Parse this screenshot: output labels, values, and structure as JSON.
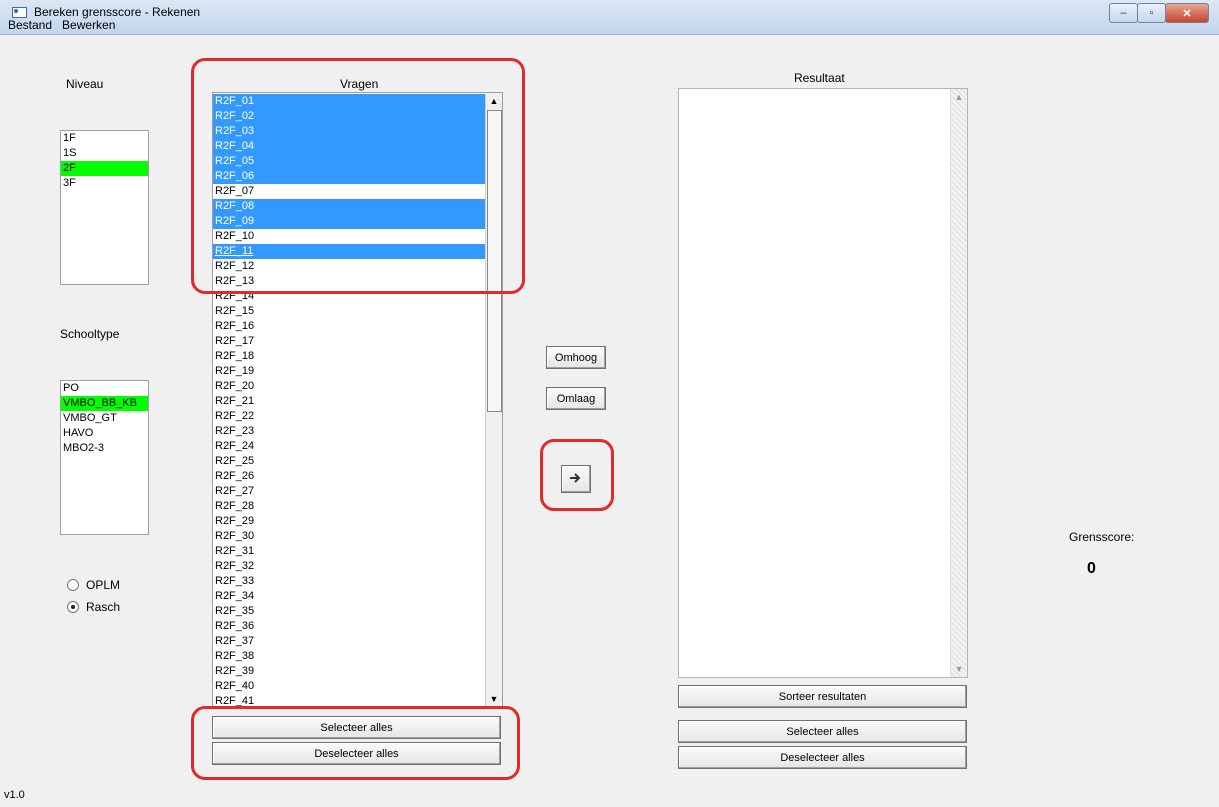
{
  "window": {
    "title": "Bereken grensscore - Rekenen",
    "min": "–",
    "max": "▫",
    "close": "✕"
  },
  "menu": [
    "Bestand",
    "Bewerken"
  ],
  "niveau": {
    "label": "Niveau",
    "items": [
      "1F",
      "1S",
      "2F",
      "3F"
    ],
    "selected": "2F"
  },
  "schooltype": {
    "label": "Schooltype",
    "items": [
      "PO",
      "VMBO_BB_KB",
      "VMBO_GT",
      "HAVO",
      "MBO2-3"
    ],
    "selected": "VMBO_BB_KB"
  },
  "model": {
    "options": [
      {
        "label": "OPLM",
        "checked": false
      },
      {
        "label": "Rasch",
        "checked": true
      }
    ]
  },
  "vragen": {
    "label": "Vragen",
    "items": [
      "R2F_01",
      "R2F_02",
      "R2F_03",
      "R2F_04",
      "R2F_05",
      "R2F_06",
      "R2F_07",
      "R2F_08",
      "R2F_09",
      "R2F_10",
      "R2F_11",
      "R2F_12",
      "R2F_13",
      "R2F_14",
      "R2F_15",
      "R2F_16",
      "R2F_17",
      "R2F_18",
      "R2F_19",
      "R2F_20",
      "R2F_21",
      "R2F_22",
      "R2F_23",
      "R2F_24",
      "R2F_25",
      "R2F_26",
      "R2F_27",
      "R2F_28",
      "R2F_29",
      "R2F_30",
      "R2F_31",
      "R2F_32",
      "R2F_33",
      "R2F_34",
      "R2F_35",
      "R2F_36",
      "R2F_37",
      "R2F_38",
      "R2F_39",
      "R2F_40",
      "R2F_41"
    ],
    "selected": [
      "R2F_01",
      "R2F_02",
      "R2F_03",
      "R2F_04",
      "R2F_05",
      "R2F_06",
      "R2F_08",
      "R2F_09",
      "R2F_11"
    ],
    "focused": "R2F_11",
    "select_all": "Selecteer alles",
    "deselect_all": "Deselecteer alles"
  },
  "middle": {
    "up": "Omhoog",
    "down": "Omlaag",
    "move_icon": "arrow-right-icon"
  },
  "resultaat": {
    "label": "Resultaat",
    "items": [],
    "sort": "Sorteer resultaten",
    "select_all": "Selecteer alles",
    "deselect_all": "Deselecteer alles"
  },
  "grensscore": {
    "label": "Grensscore:",
    "value": "0"
  },
  "version": "v1.0",
  "colors": {
    "selected": "#3399ff",
    "highlight_green": "#00ff00",
    "annotation": "#e22a2a"
  }
}
